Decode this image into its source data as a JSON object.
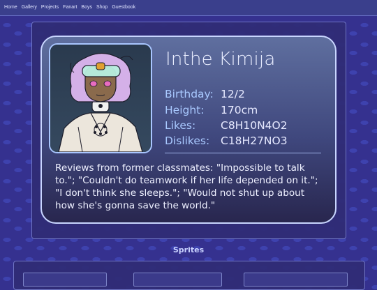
{
  "nav": {
    "links": [
      "Home",
      "Gallery",
      "Projects",
      "Fanart",
      "Boys",
      "Shop",
      "Guestbook"
    ]
  },
  "profile": {
    "name": "Inthe Kimija",
    "fields": [
      {
        "label": "Birthday:",
        "value": "12/2"
      },
      {
        "label": "Height:",
        "value": "170cm"
      },
      {
        "label": "Likes:",
        "value": "C8H10N4O2"
      },
      {
        "label": "Dislikes:",
        "value": "C18H27NO3"
      }
    ],
    "reviews": "Reviews from former classmates: \"Impossible to talk to.\"; \"Couldn't do teamwork if her life depended on it.\"; \"I don't think she sleeps.\"; \"Would not shut up about how she's gonna save the world.\""
  },
  "sprites": {
    "title": "Sprites"
  },
  "colors": {
    "background": "#35318f",
    "card_border": "#c9d6ff",
    "label": "#a9c9ff",
    "text": "#e6e9ff"
  },
  "icons": {
    "portrait": "character-portrait"
  }
}
